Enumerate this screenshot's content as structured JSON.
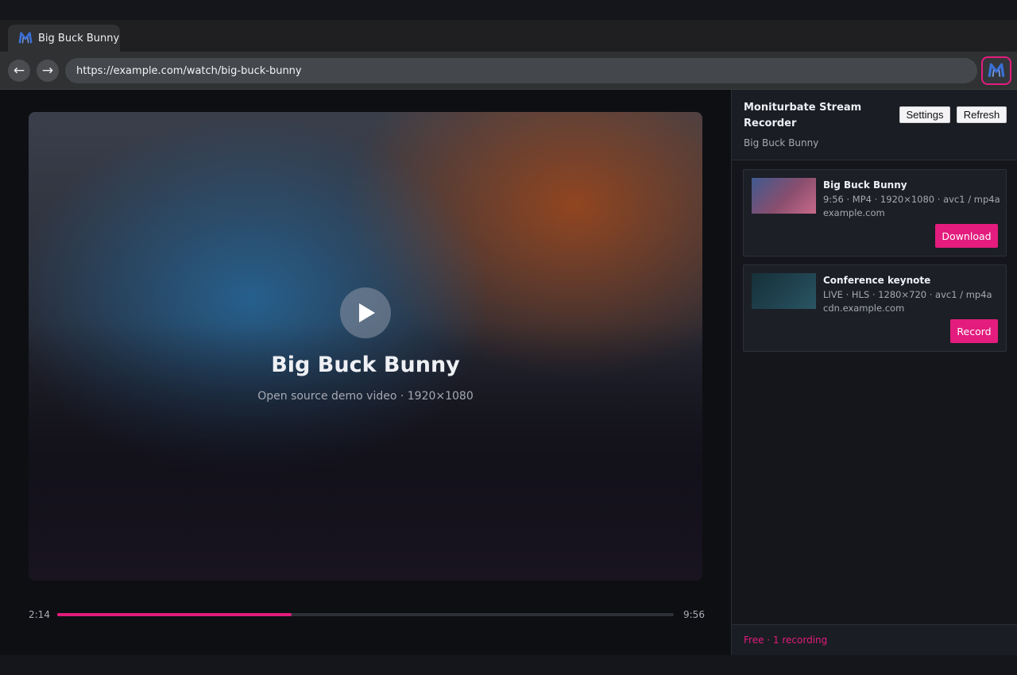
{
  "browser": {
    "tab": {
      "title": "Big Buck Bunny",
      "favicon": "monitor-m-logo-icon"
    },
    "nav": {
      "back_icon": "←",
      "forward_icon": "→"
    },
    "url": "https://example.com/watch/big-buck-bunny",
    "extension_icon": "monitor-m-logo-icon"
  },
  "player": {
    "title": "Big Buck Bunny",
    "subtitle": "Open source demo video · 1920×1080",
    "current_time": "2:14",
    "total_time": "9:56",
    "progress_fraction": 0.38
  },
  "panel": {
    "title": "Moniturbate Stream Recorder",
    "subtitle": "Big Buck Bunny",
    "settings_label": "Settings",
    "refresh_label": "Refresh",
    "streams": [
      {
        "title": "Big Buck Bunny",
        "meta": "9:56 · MP4 · 1920×1080 · avc1 / mp4a",
        "host": "example.com",
        "action": "Download"
      },
      {
        "title": "Conference keynote",
        "meta": "LIVE · HLS · 1280×720 · avc1 / mp4a",
        "host": "cdn.example.com",
        "action": "Record"
      }
    ],
    "footer": "Free · 1 recording"
  },
  "colors": {
    "accent": "#e31c7d",
    "logo_blue": "#3b6fd6"
  }
}
